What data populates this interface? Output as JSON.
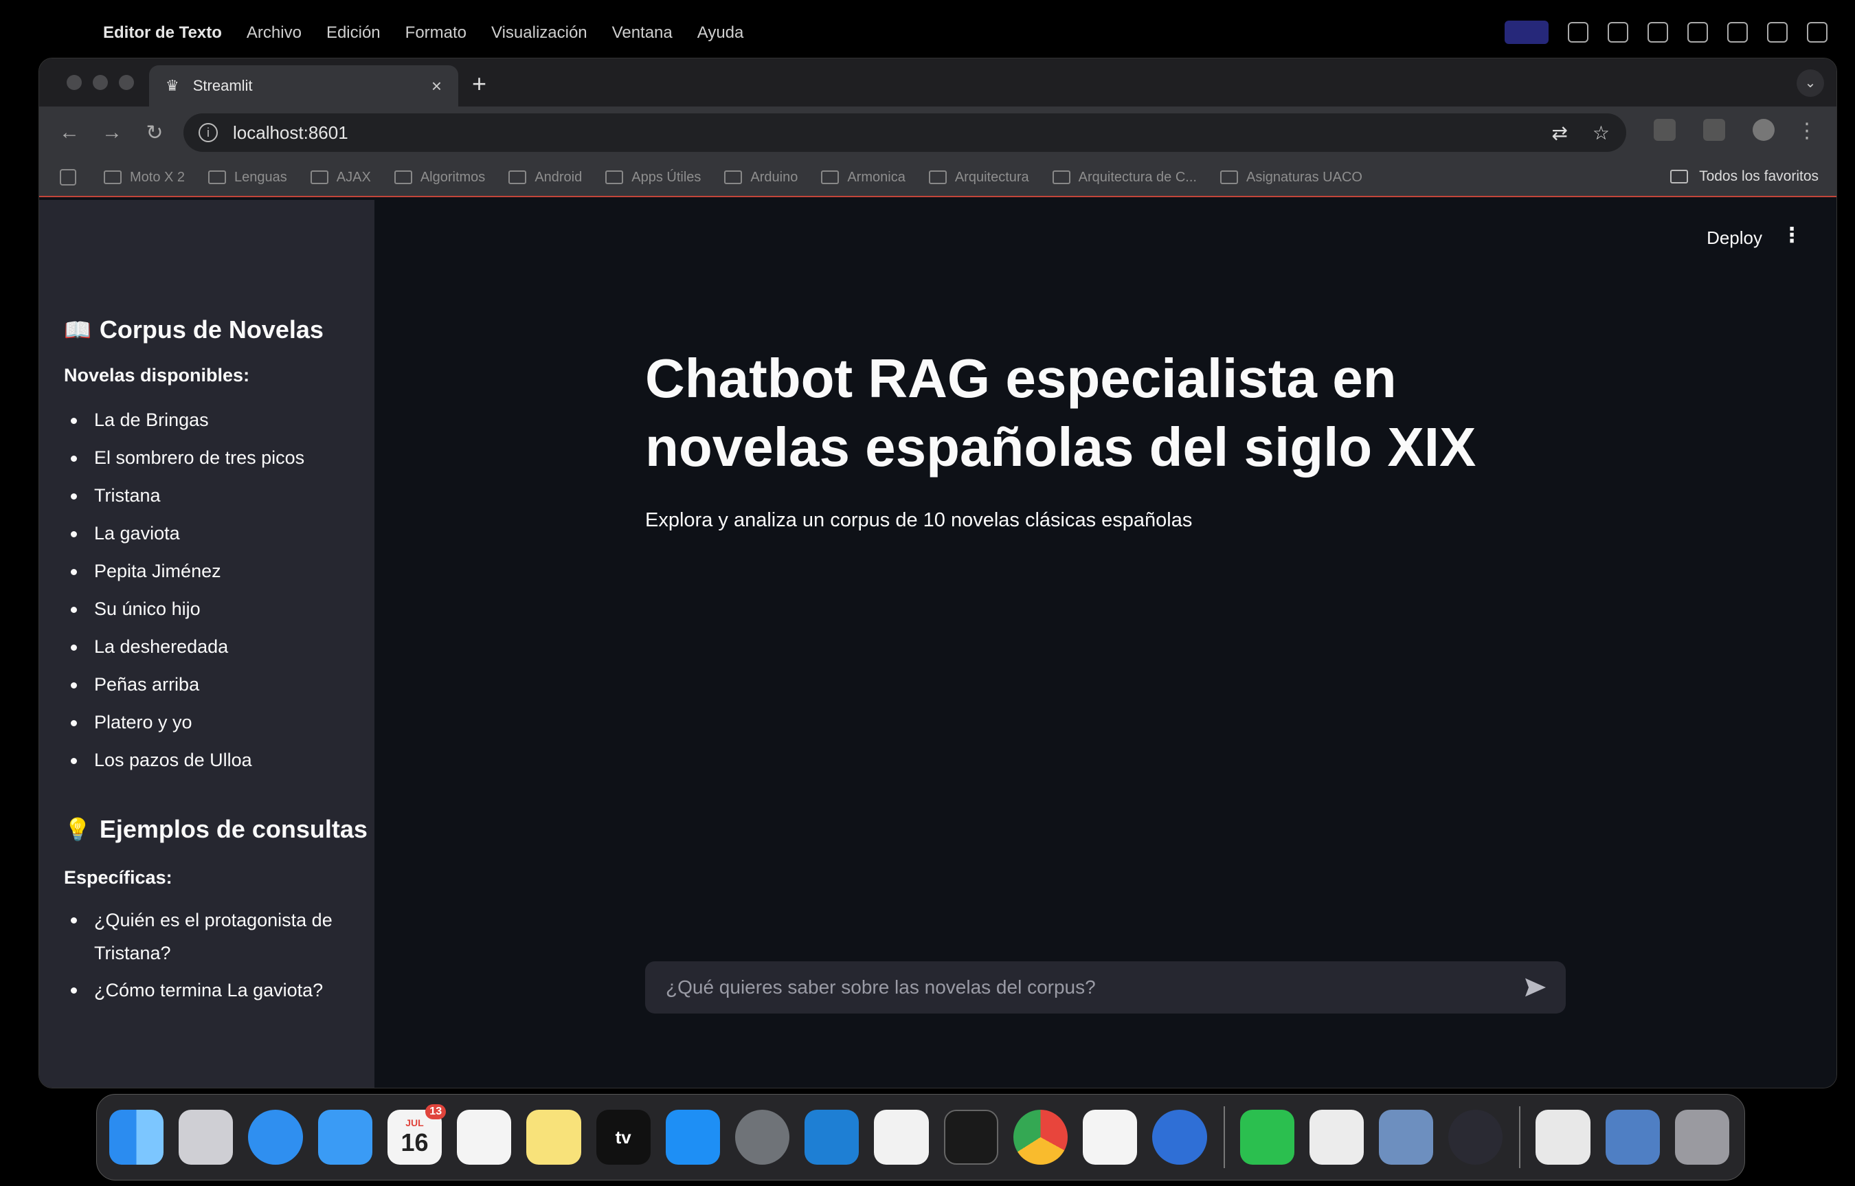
{
  "menubar": {
    "app_name": "Editor de Texto",
    "items": [
      "Archivo",
      "Edición",
      "Formato",
      "Visualización",
      "Ventana",
      "Ayuda"
    ]
  },
  "browser": {
    "tab_title": "Streamlit",
    "url": "localhost:8601",
    "bookmarks": [
      "Moto X 2",
      "Lenguas",
      "AJAX",
      "Algoritmos",
      "Android",
      "Apps Útiles",
      "Arduino",
      "Armonica",
      "Arquitectura",
      "Arquitectura de C...",
      "Asignaturas UACO"
    ],
    "all_bookmarks_label": "Todos los favoritos"
  },
  "header": {
    "deploy_label": "Deploy"
  },
  "sidebar": {
    "corpus_title": "Corpus de Novelas",
    "corpus_emoji": "📖",
    "available_label": "Novelas disponibles:",
    "novels": [
      "La de Bringas",
      "El sombrero de tres picos",
      "Tristana",
      "La gaviota",
      "Pepita Jiménez",
      "Su único hijo",
      "La desheredada",
      "Peñas arriba",
      "Platero y yo",
      "Los pazos de Ulloa"
    ],
    "examples_title": "Ejemplos de consultas",
    "examples_emoji": "💡",
    "specific_label": "Específicas:",
    "examples": [
      "¿Quién es el protagonista de Tristana?",
      "¿Cómo termina La gaviota?"
    ]
  },
  "main": {
    "title": "Chatbot RAG especialista en novelas españolas del siglo XIX",
    "caption": "Explora y analiza un corpus de 10 novelas clásicas españolas",
    "chat_placeholder": "¿Qué quieres saber sobre las novelas del corpus?"
  },
  "dock": {
    "calendar_month": "JUL",
    "calendar_day": "16",
    "calendar_badge": "13",
    "tv_label": "tv",
    "apps": [
      "finder-icon",
      "launchpad-icon",
      "safari-icon",
      "mail-icon",
      "calendar-icon",
      "reminders-icon",
      "notes-icon",
      "apple-tv-icon",
      "app-store-icon",
      "system-settings-icon",
      "vscode-icon",
      "freeform-icon",
      "terminal-icon",
      "chrome-icon",
      "chatgpt-icon",
      "thunderbird-icon",
      "whatsapp-icon",
      "textedit-icon",
      "preview-icon",
      "obs-icon",
      "document-icon",
      "downloads-icon",
      "trash-icon"
    ]
  },
  "colors": {
    "app_bg": "#0e1117",
    "sidebar_bg": "#262730",
    "text": "#fafafa",
    "accent_line": "#c2453a"
  }
}
